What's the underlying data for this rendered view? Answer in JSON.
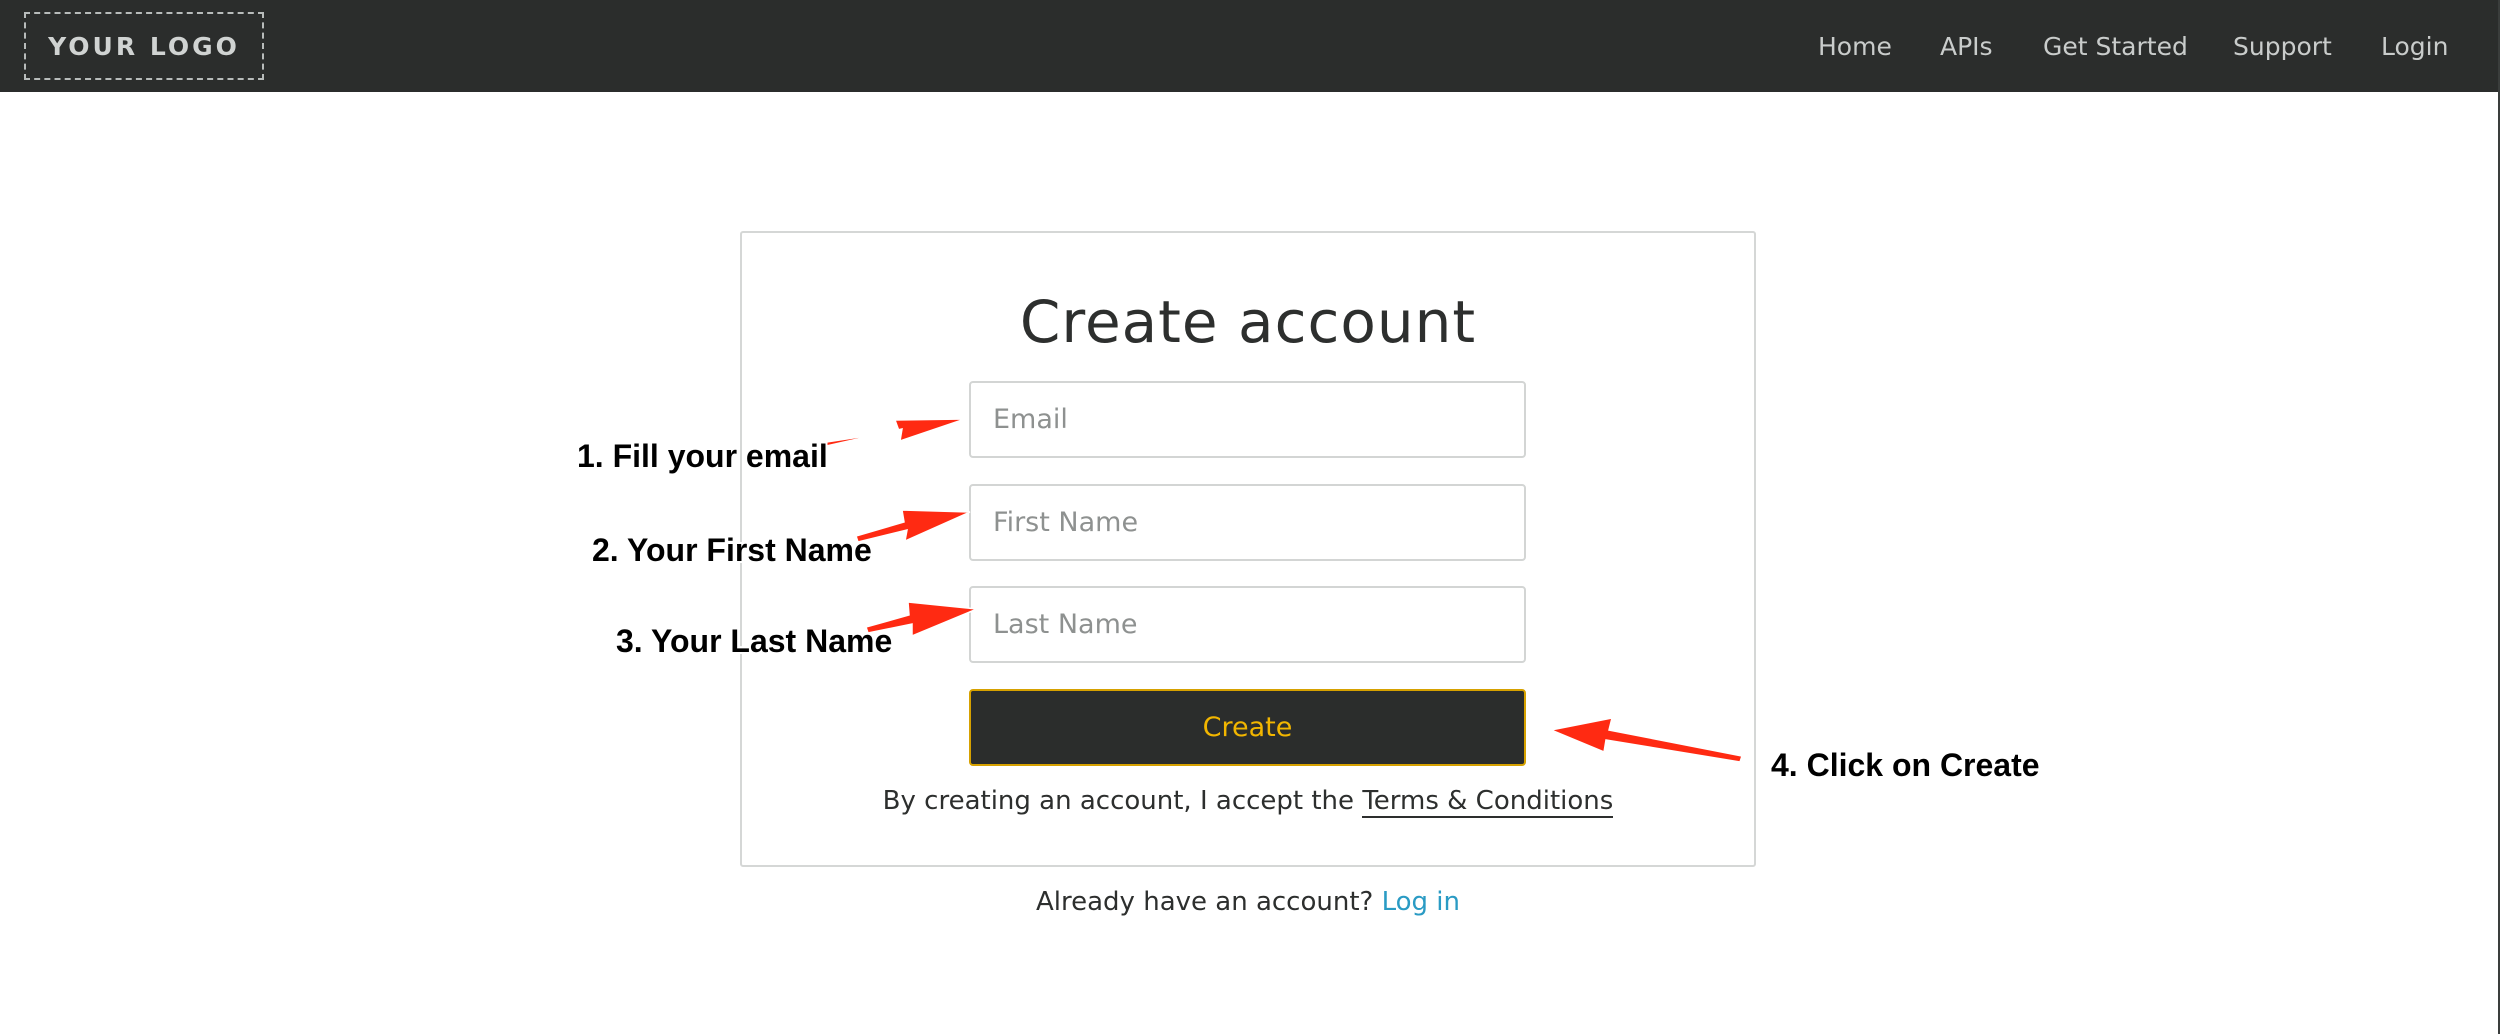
{
  "navbar": {
    "logo_text": "YOUR LOGO",
    "items": [
      {
        "label": "Home"
      },
      {
        "label": "APIs"
      },
      {
        "label": "Get Started"
      },
      {
        "label": "Support"
      },
      {
        "label": "Login"
      }
    ]
  },
  "form": {
    "title": "Create account",
    "email_placeholder": "Email",
    "first_name_placeholder": "First Name",
    "last_name_placeholder": "Last Name",
    "create_label": "Create",
    "terms_prefix": "By creating an account, I accept the ",
    "terms_link": "Terms & Conditions",
    "login_prefix": "Already have an account? ",
    "login_link": "Log in"
  },
  "annotations": {
    "step1": "1. Fill your email",
    "step2": "2. Your First Name",
    "step3": "3. Your Last Name",
    "step4": "4. Click on Create"
  },
  "colors": {
    "navbar_bg": "#2b2d2c",
    "button_text": "#f2b600",
    "button_border": "#d6a100",
    "link": "#2a9bc4",
    "annotation_arrow": "#ff2a12"
  }
}
